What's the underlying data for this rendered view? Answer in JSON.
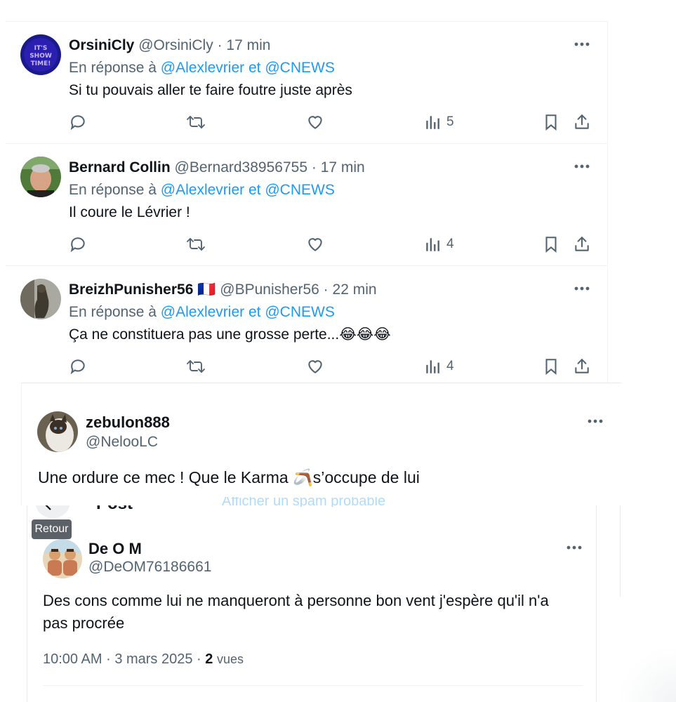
{
  "replies": [
    {
      "name": "OrsiniCly",
      "handle": "@OrsiniCly",
      "time": "17 min",
      "reply_prefix": "En réponse à",
      "mention1": "@Alexlevrier",
      "conj": "et",
      "mention2": "@CNEWS",
      "text": "Si tu pouvais aller te faire foutre juste après",
      "views": "5",
      "avatar_text": "IT'S SHOW TIME!"
    },
    {
      "name": "Bernard Collin",
      "handle": "@Bernard38956755",
      "time": "17 min",
      "reply_prefix": "En réponse à",
      "mention1": "@Alexlevrier",
      "conj": "et",
      "mention2": "@CNEWS",
      "text": "Il coure le Lévrier !",
      "views": "4"
    },
    {
      "name": "BreizhPunisher56",
      "handle": "@BPunisher56",
      "time": "22 min",
      "reply_prefix": "En réponse à",
      "mention1": "@Alexlevrier",
      "conj": "et",
      "mention2": "@CNEWS",
      "text": "Ça ne constituera pas une grosse perte...😂😂😂",
      "views": "4",
      "flag": "🇫🇷"
    }
  ],
  "post_zebulon": {
    "name": "zebulon888",
    "handle": "@NelooLC",
    "text_before": "Une ordure ce mec ! Que le Karma ",
    "emoji": "🪃",
    "text_after": "s’occupe de lui",
    "ghost_text": "Afficher un spam probable"
  },
  "post_header": {
    "title": "Post"
  },
  "tooltip": {
    "label": "Retour"
  },
  "post_deom": {
    "name": "De O M",
    "handle": "@DeOM76186661",
    "text": "Des cons comme lui ne manqueront à personne bon vent j'espère qu'il n'a pas procrée",
    "time": "10:00 AM",
    "date": "3 mars 2025",
    "views_count": "2",
    "views_label": "vues"
  },
  "colors": {
    "accent": "#1d9bf0",
    "text": "#0f1419",
    "muted": "#536471",
    "border": "#eff3f4"
  }
}
